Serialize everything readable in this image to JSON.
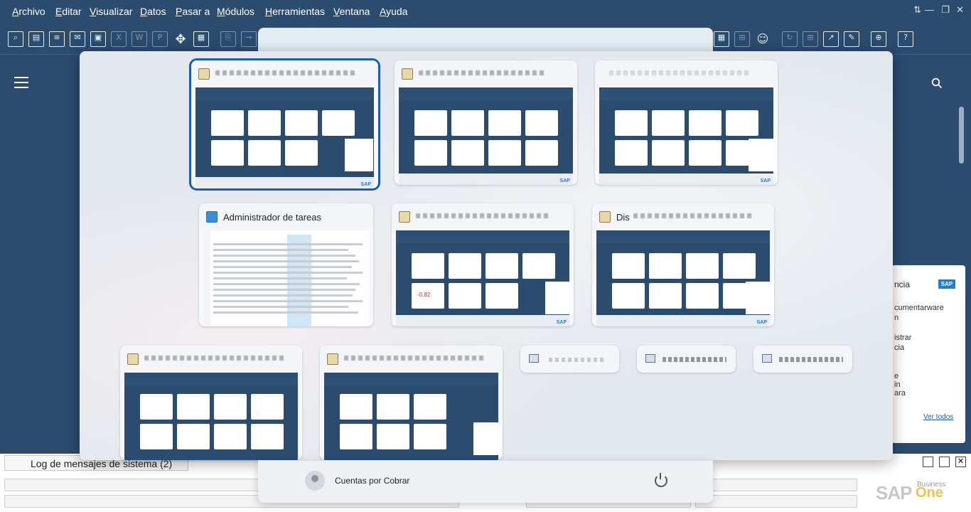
{
  "menubar": {
    "items": [
      "Archivo",
      "Editar",
      "Visualizar",
      "Datos",
      "Pasar a",
      "Módulos",
      "Herramientas",
      "Ventana",
      "Ayuda"
    ]
  },
  "toolbar": {
    "help_glyph": "?"
  },
  "notification": {
    "title": "ncia",
    "brand": "SAP",
    "lines": [
      "cumentarware",
      "n",
      "istrar",
      "cia",
      "e",
      "in",
      "ara"
    ],
    "more_link": "Ver todos"
  },
  "switcher": {
    "task_manager_title": "Administrador de tareas",
    "tile_partial_title": "Dis",
    "preview_value": "-0.82"
  },
  "bottom": {
    "log_tab": "Log de mensajes de sistema (2)",
    "brand_sap": "SAP",
    "brand_business": "Business",
    "brand_one": "One"
  },
  "user": {
    "name": "Cuentas por Cobrar"
  }
}
